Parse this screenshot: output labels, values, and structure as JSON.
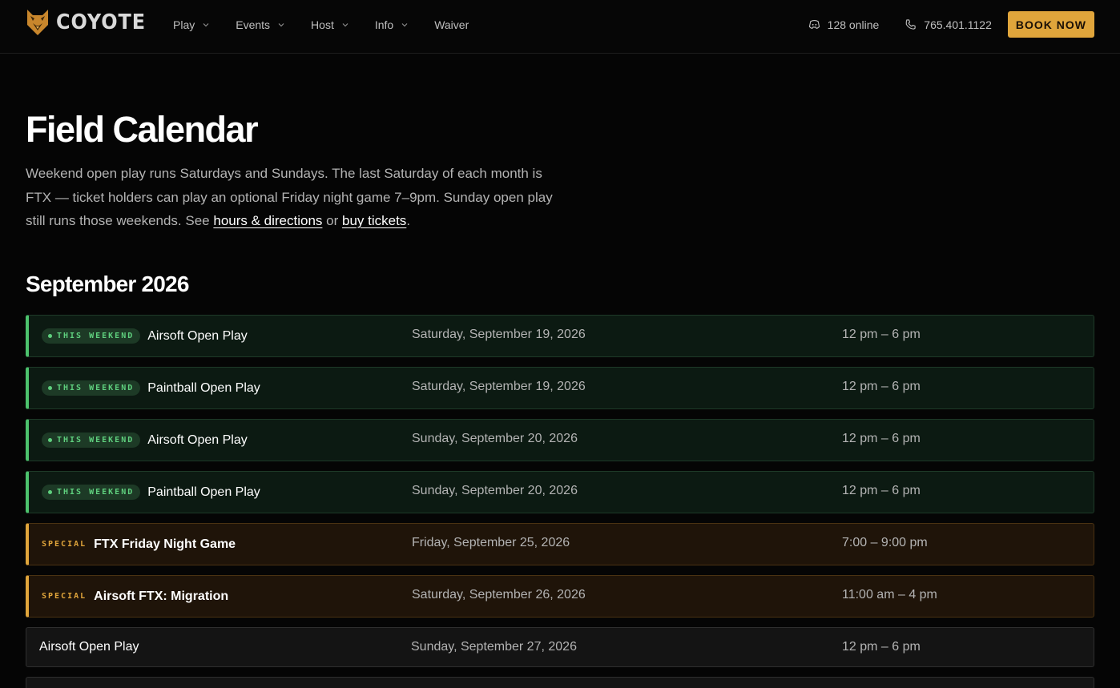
{
  "header": {
    "logo_text": "COYOTE",
    "nav": [
      "Play",
      "Events",
      "Host",
      "Info",
      "Waiver"
    ],
    "online": "128 online",
    "phone": "765.401.1122",
    "book_label": "BOOK NOW"
  },
  "page": {
    "title": "Field Calendar",
    "intro_text": "Weekend open play runs Saturdays and Sundays. The last Saturday of each month is FTX — ticket holders can play an optional Friday night game 7–9pm. Sunday open play still runs those weekends. See ",
    "link_hours": "hours & directions",
    "intro_or": " or ",
    "link_tickets": "buy tickets",
    "intro_end": ".",
    "month": "September 2026"
  },
  "badges": {
    "weekend": "THIS WEEKEND",
    "special": "SPECIAL"
  },
  "events": [
    {
      "kind": "weekend",
      "name": "Airsoft Open Play",
      "date": "Saturday, September 19, 2026",
      "time": "12 pm – 6 pm"
    },
    {
      "kind": "weekend",
      "name": "Paintball Open Play",
      "date": "Saturday, September 19, 2026",
      "time": "12 pm – 6 pm"
    },
    {
      "kind": "weekend",
      "name": "Airsoft Open Play",
      "date": "Sunday, September 20, 2026",
      "time": "12 pm – 6 pm"
    },
    {
      "kind": "weekend",
      "name": "Paintball Open Play",
      "date": "Sunday, September 20, 2026",
      "time": "12 pm – 6 pm"
    },
    {
      "kind": "special",
      "name": "FTX Friday Night Game",
      "date": "Friday, September 25, 2026",
      "time": "7:00 – 9:00 pm"
    },
    {
      "kind": "special",
      "name": "Airsoft FTX: Migration",
      "date": "Saturday, September 26, 2026",
      "time": "11:00 am – 4 pm"
    },
    {
      "kind": "plain",
      "name": "Airsoft Open Play",
      "date": "Sunday, September 27, 2026",
      "time": "12 pm – 6 pm"
    }
  ],
  "colors": {
    "accent": "#e0a53b",
    "weekend_green": "#4cc26d"
  }
}
